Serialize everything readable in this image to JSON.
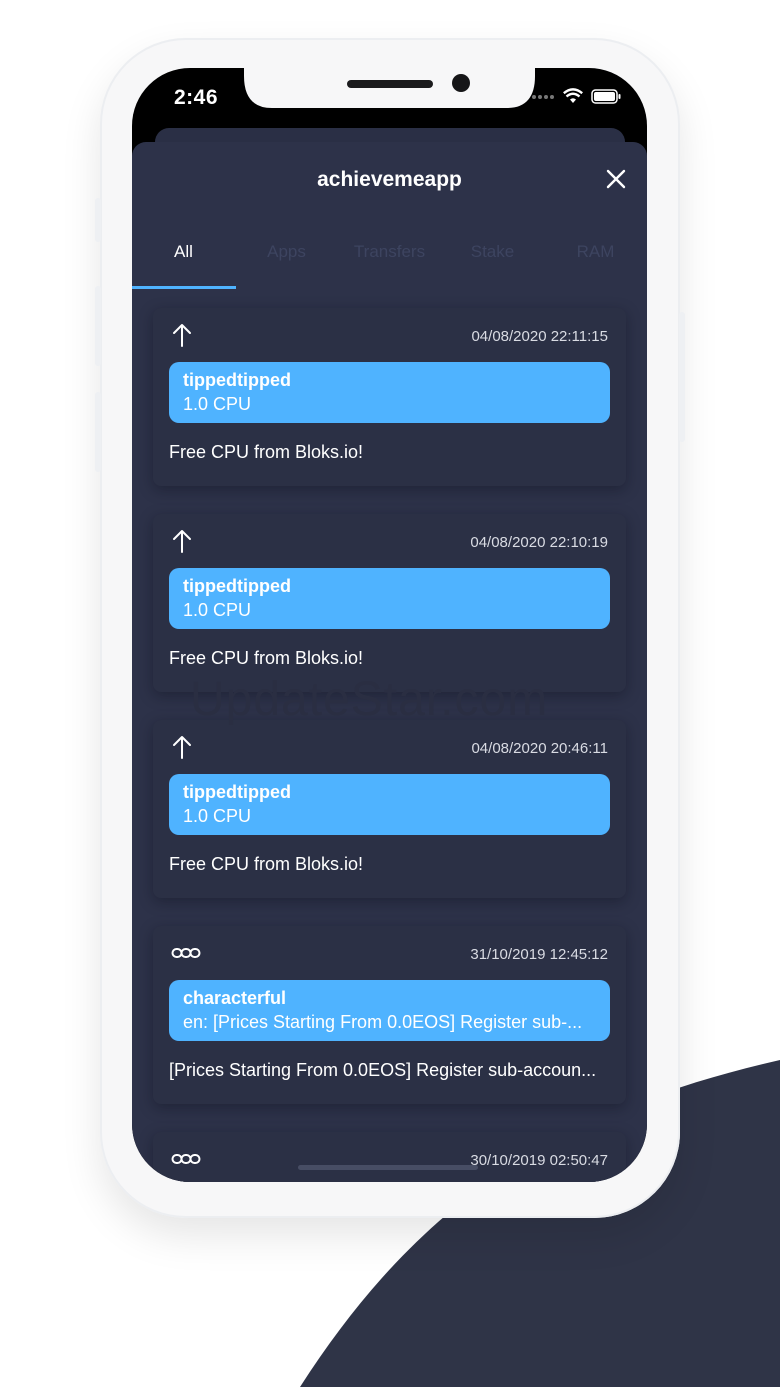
{
  "status_bar": {
    "time": "2:46",
    "signal_icon": "signal-dots-icon",
    "wifi_icon": "wifi-icon",
    "battery_icon": "battery-icon"
  },
  "sheet": {
    "title": "achievemeapp",
    "close_icon": "close-icon"
  },
  "tabs": [
    {
      "label": "All",
      "active": true
    },
    {
      "label": "Apps",
      "active": false
    },
    {
      "label": "Transfers",
      "active": false
    },
    {
      "label": "Stake",
      "active": false
    },
    {
      "label": "RAM",
      "active": false
    }
  ],
  "transactions": [
    {
      "icon": "arrow-up-icon",
      "date": "04/08/2020 22:11:15",
      "account": "tippedtipped",
      "detail": "1.0 CPU",
      "memo": "Free CPU from Bloks.io!"
    },
    {
      "icon": "arrow-up-icon",
      "date": "04/08/2020 22:10:19",
      "account": "tippedtipped",
      "detail": "1.0 CPU",
      "memo": "Free CPU from Bloks.io!"
    },
    {
      "icon": "arrow-up-icon",
      "date": "04/08/2020 20:46:11",
      "account": "tippedtipped",
      "detail": "1.0 CPU",
      "memo": "Free CPU from Bloks.io!"
    },
    {
      "icon": "link-chain-icon",
      "date": "31/10/2019 12:45:12",
      "account": "characterful",
      "detail": "en: [Prices Starting From 0.0EOS] Register sub-...",
      "memo": "[Prices Starting From 0.0EOS] Register sub-accoun..."
    },
    {
      "icon": "link-chain-icon",
      "date": "30/10/2019 02:50:47",
      "account": "",
      "detail": "",
      "memo": ""
    }
  ],
  "watermark": "UpdateStar.com",
  "colors": {
    "background": "#ffffff",
    "curve": "#2f3447",
    "sheet": "#2d3249",
    "card": "#2b3045",
    "accent": "#4fb3ff",
    "inactive_tab": "#3d4460"
  }
}
